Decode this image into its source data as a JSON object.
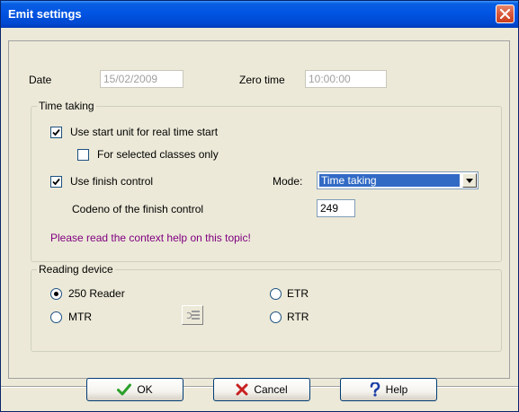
{
  "window": {
    "title": "Emit settings"
  },
  "date": {
    "label": "Date",
    "value": "15/02/2009"
  },
  "zero_time": {
    "label": "Zero time",
    "value": "10:00:00"
  },
  "time_taking": {
    "legend": "Time taking",
    "use_start_unit": {
      "label": "Use start unit for real time start",
      "checked": true
    },
    "selected_classes": {
      "label": "For selected classes only",
      "checked": false
    },
    "use_finish_control": {
      "label": "Use finish control",
      "checked": true
    },
    "mode": {
      "label": "Mode:",
      "value": "Time taking"
    },
    "codeno": {
      "label": "Codeno of the finish control",
      "value": "249"
    },
    "help_text": "Please read the context help on this topic!"
  },
  "reading_device": {
    "legend": "Reading device",
    "options": [
      {
        "label": "250 Reader",
        "selected": true
      },
      {
        "label": "ETR",
        "selected": false
      },
      {
        "label": "MTR",
        "selected": false
      },
      {
        "label": "RTR",
        "selected": false
      }
    ]
  },
  "buttons": {
    "ok": "OK",
    "cancel": "Cancel",
    "help": "Help"
  },
  "colors": {
    "titlebar": "#0054e3",
    "selection": "#316ac5",
    "help_text": "#800080",
    "ok_check": "#2aa02a",
    "cancel_x": "#c82020",
    "help_q": "#1a3ea8"
  },
  "icons": [
    "close-icon",
    "check-icon",
    "dropdown-arrow-icon",
    "reader-settings-icon",
    "ok-check-icon",
    "cancel-x-icon",
    "help-question-icon"
  ]
}
